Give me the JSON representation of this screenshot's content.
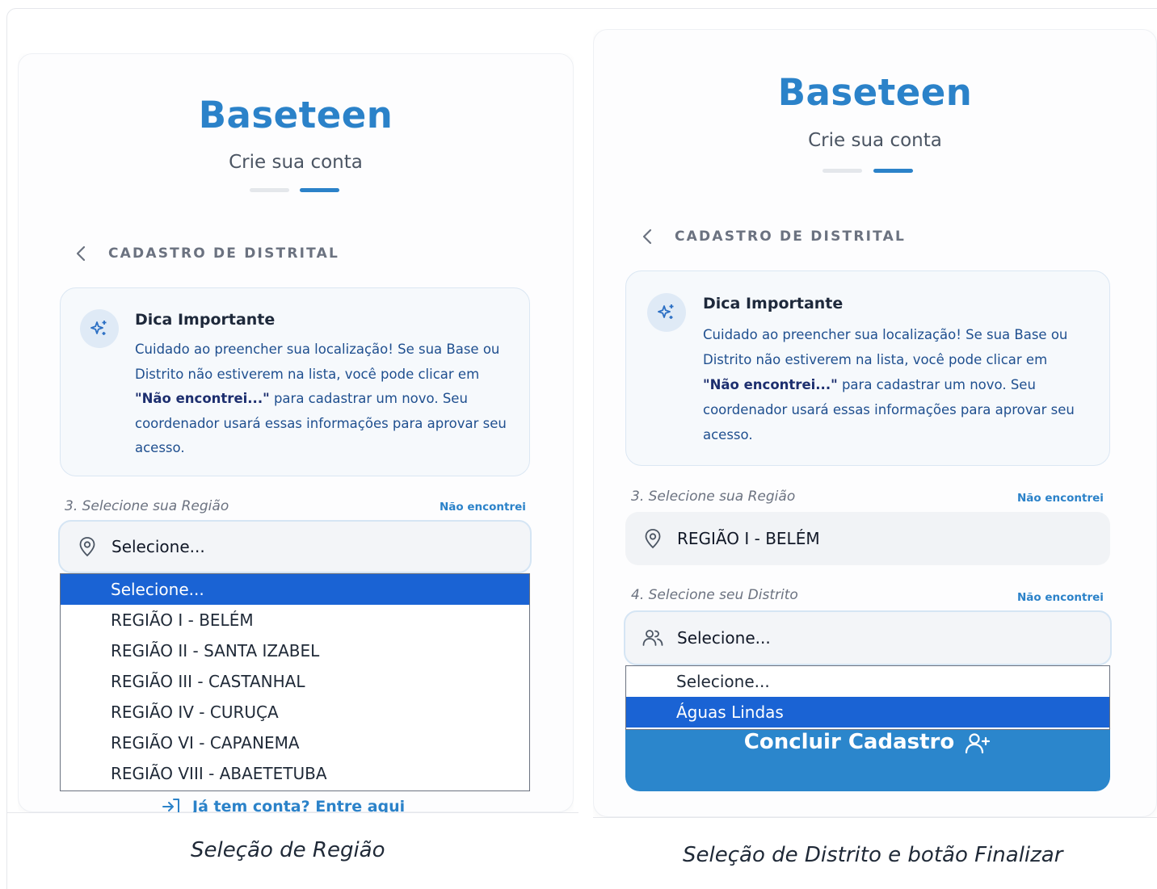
{
  "left_screen": {
    "brand": "Baseteen",
    "subtitle": "Crie sua conta",
    "section_title": "CADASTRO DE DISTRITAL",
    "tip": {
      "title": "Dica Importante",
      "body_prefix": "Cuidado ao preencher sua localização! Se sua Base ou Distrito não estiverem na lista, você pode clicar em ",
      "body_bold": "\"Não encontrei...\"",
      "body_suffix": " para cadastrar um novo. Seu coordenador usará essas informações para aprovar seu acesso."
    },
    "region_label": "3. Selecione sua Região",
    "not_found": "Não encontrei",
    "region_value": "Selecione...",
    "region_options": [
      "Selecione...",
      "REGIÃO I - BELÉM",
      "REGIÃO II - SANTA IZABEL",
      "REGIÃO III - CASTANHAL",
      "REGIÃO IV - CURUÇA",
      "REGIÃO VI - CAPANEMA",
      "REGIÃO VIII - ABAETETUBA"
    ],
    "login_link": "Já tem conta? Entre aqui"
  },
  "right_screen": {
    "brand": "Baseteen",
    "subtitle": "Crie sua conta",
    "section_title": "CADASTRO DE DISTRITAL",
    "tip": {
      "title": "Dica Importante",
      "body_prefix": "Cuidado ao preencher sua localização! Se sua Base ou Distrito não estiverem na lista, você pode clicar em ",
      "body_bold": "\"Não encontrei...\"",
      "body_suffix": " para cadastrar um novo. Seu coordenador usará essas informações para aprovar seu acesso."
    },
    "region_label": "3. Selecione sua Região",
    "region_not_found": "Não encontrei",
    "region_value": "REGIÃO I - BELÉM",
    "district_label": "4. Selecione seu Distrito",
    "district_not_found": "Não encontrei",
    "district_value": "Selecione...",
    "district_options": [
      "Selecione...",
      "Águas Lindas"
    ],
    "submit_label": "Concluir Cadastro"
  },
  "captions": {
    "left": "Seleção de Região",
    "right": "Seleção de Distrito e botão Finalizar"
  },
  "colors": {
    "brand": "#2b82c9",
    "selected_option": "#1a63d4",
    "button": "#2b86cc"
  }
}
